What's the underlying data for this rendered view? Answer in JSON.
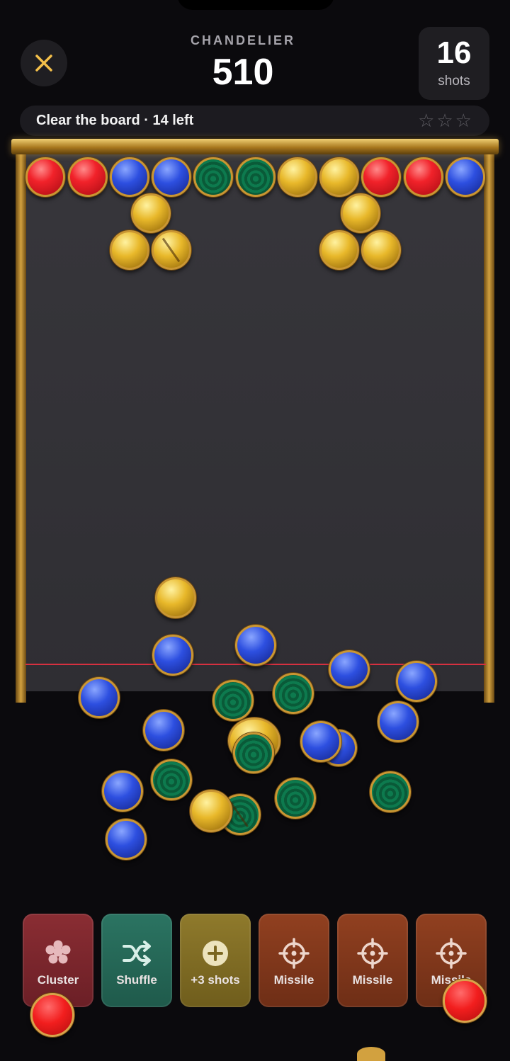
{
  "header": {
    "level_name": "CHANDELIER",
    "score": "510",
    "shots_count": "16",
    "shots_label": "shots"
  },
  "goal": {
    "text": "Clear the board · 14 left",
    "stars": "☆☆☆",
    "stars_earned": 0
  },
  "powerups": [
    {
      "label": "Cluster",
      "icon": "cluster-icon"
    },
    {
      "label": "Shuffle",
      "icon": "shuffle-icon"
    },
    {
      "label": "+3 shots",
      "icon": "plus-icon"
    },
    {
      "label": "Missile",
      "icon": "crosshair-icon"
    },
    {
      "label": "Missile",
      "icon": "crosshair-icon"
    },
    {
      "label": "Missile",
      "icon": "crosshair-icon"
    }
  ],
  "colors": {
    "red": "#f1222a",
    "blue": "#2d4fe0",
    "green": "#0d7a4e",
    "yellow": "#e8b82a",
    "gold_frame": "#c99633",
    "danger_line": "#d63040"
  }
}
